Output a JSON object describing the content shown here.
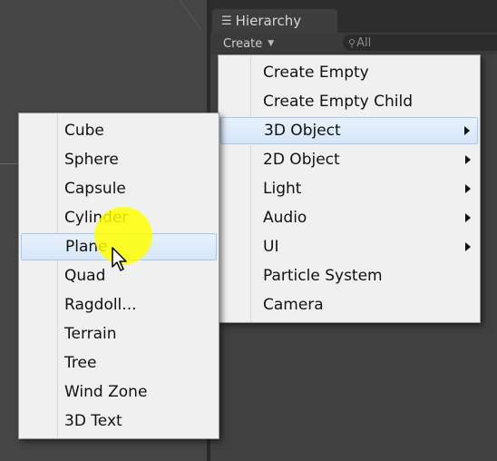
{
  "hierarchy": {
    "tab_label": "Hierarchy",
    "create_label": "Create",
    "search_placeholder": "All"
  },
  "create_menu": {
    "items": [
      {
        "label": "Create Empty",
        "submenu": false
      },
      {
        "label": "Create Empty Child",
        "submenu": false
      },
      {
        "label": "3D Object",
        "submenu": true,
        "highlighted": true
      },
      {
        "label": "2D Object",
        "submenu": true
      },
      {
        "label": "Light",
        "submenu": true
      },
      {
        "label": "Audio",
        "submenu": true
      },
      {
        "label": "UI",
        "submenu": true
      },
      {
        "label": "Particle System",
        "submenu": false
      },
      {
        "label": "Camera",
        "submenu": false
      }
    ]
  },
  "object3d_menu": {
    "items": [
      {
        "label": "Cube"
      },
      {
        "label": "Sphere"
      },
      {
        "label": "Capsule"
      },
      {
        "label": "Cylinder"
      },
      {
        "label": "Plane",
        "highlighted": true
      },
      {
        "label": "Quad"
      },
      {
        "label": "Ragdoll..."
      },
      {
        "label": "Terrain"
      },
      {
        "label": "Tree"
      },
      {
        "label": "Wind Zone"
      },
      {
        "label": "3D Text"
      }
    ]
  },
  "colors": {
    "menu_bg": "#f0f0f0",
    "highlight": "#d6e6f8",
    "cursor_glow": "#ffff00"
  }
}
